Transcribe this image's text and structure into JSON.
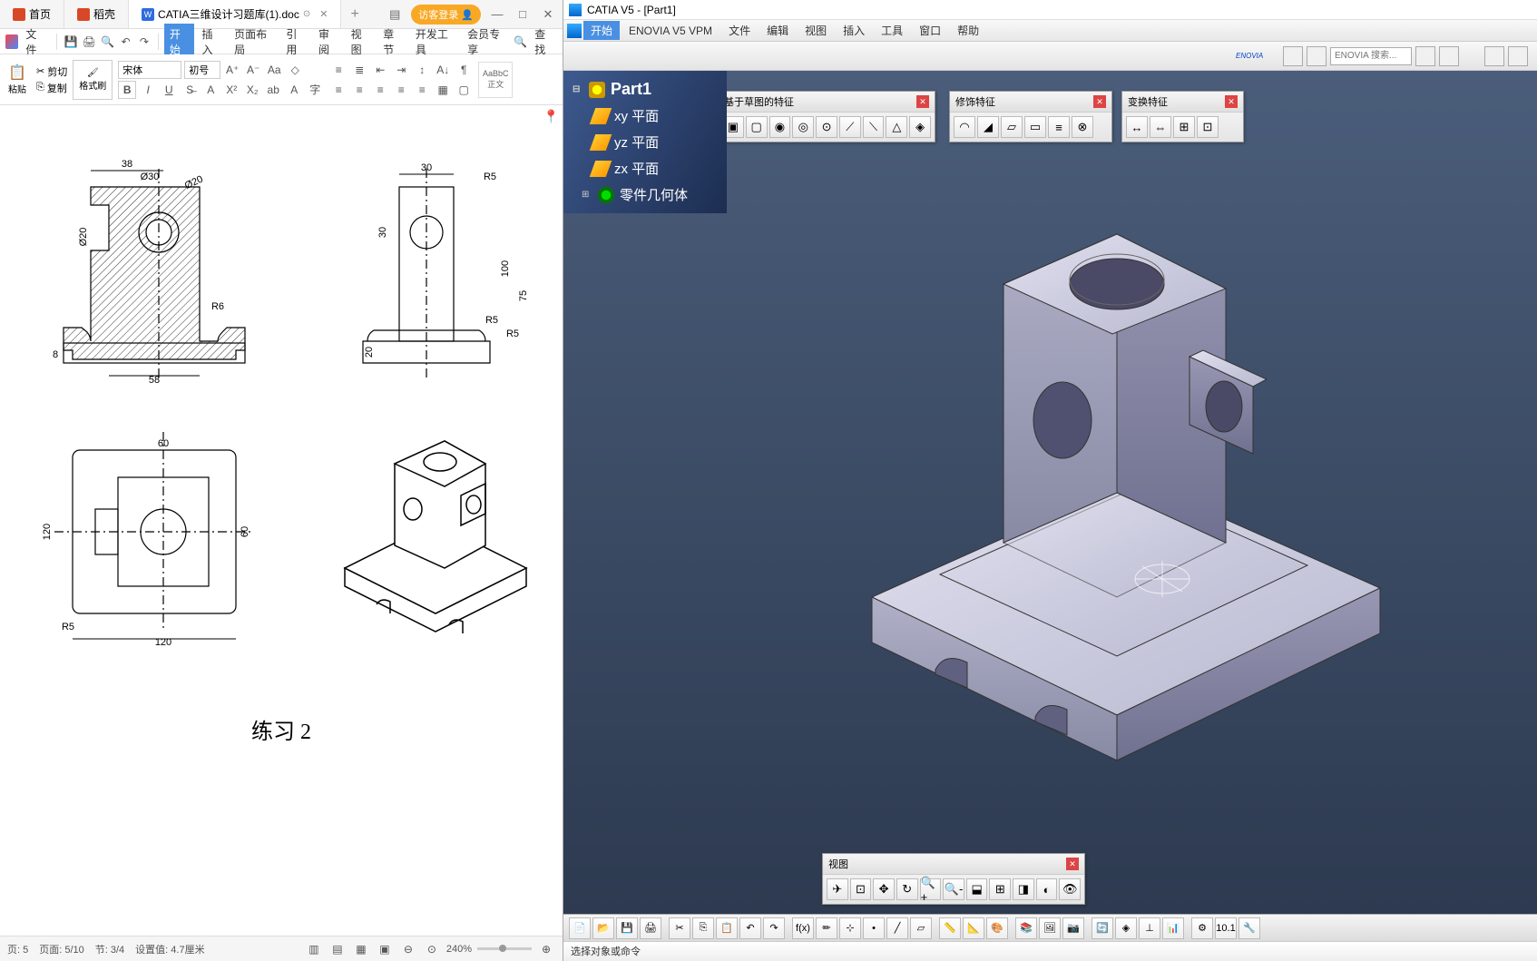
{
  "wps": {
    "tabs": [
      {
        "label": "首页"
      },
      {
        "label": "稻壳"
      },
      {
        "label": "CATIA三维设计习题库(1).doc"
      }
    ],
    "login": "访客登录",
    "menu": {
      "file": "文件",
      "items": [
        "开始",
        "插入",
        "页面布局",
        "引用",
        "审阅",
        "视图",
        "章节",
        "开发工具",
        "会员专享"
      ],
      "search": "查找"
    },
    "ribbon": {
      "paste": "粘贴",
      "cut": "剪切",
      "copy": "复制",
      "fmt_painter": "格式刷",
      "font_name": "宋体",
      "font_size": "初号",
      "style1": "AaBbC",
      "style1_name": "正文"
    },
    "doc": {
      "exercise": "练习 2",
      "dims": {
        "d38": "38",
        "d30a": "Ø30",
        "d20a": "Ø20",
        "d20b": "Ø20",
        "d30b": "30",
        "r5a": "R5",
        "r5b": "R5",
        "r5c": "R5",
        "r5d": "R5",
        "d100": "100",
        "d75": "75",
        "d30c": "30",
        "d20c": "20",
        "d8": "8",
        "d58": "58",
        "r6": "R6",
        "d60a": "60",
        "d60b": "60",
        "d120a": "120",
        "d120b": "120"
      }
    },
    "status": {
      "page_label": "页: 5",
      "page_of": "页面: 5/10",
      "section": "节: 3/4",
      "pos": "设置值: 4.7厘米",
      "zoom": "240%"
    }
  },
  "catia": {
    "title": "CATIA V5 - [Part1]",
    "menu": [
      "开始",
      "ENOVIA V5 VPM",
      "文件",
      "编辑",
      "视图",
      "插入",
      "工具",
      "窗口",
      "帮助"
    ],
    "enovia_search": "ENOVIA 搜索...",
    "tree": {
      "root": "Part1",
      "xy": "xy 平面",
      "yz": "yz 平面",
      "zx": "zx 平面",
      "body": "零件几何体"
    },
    "toolbars": {
      "sketch_based": "基于草图的特征",
      "dress_up": "修饰特征",
      "transform": "变换特征",
      "view": "视图"
    },
    "status": "选择对象或命令"
  }
}
